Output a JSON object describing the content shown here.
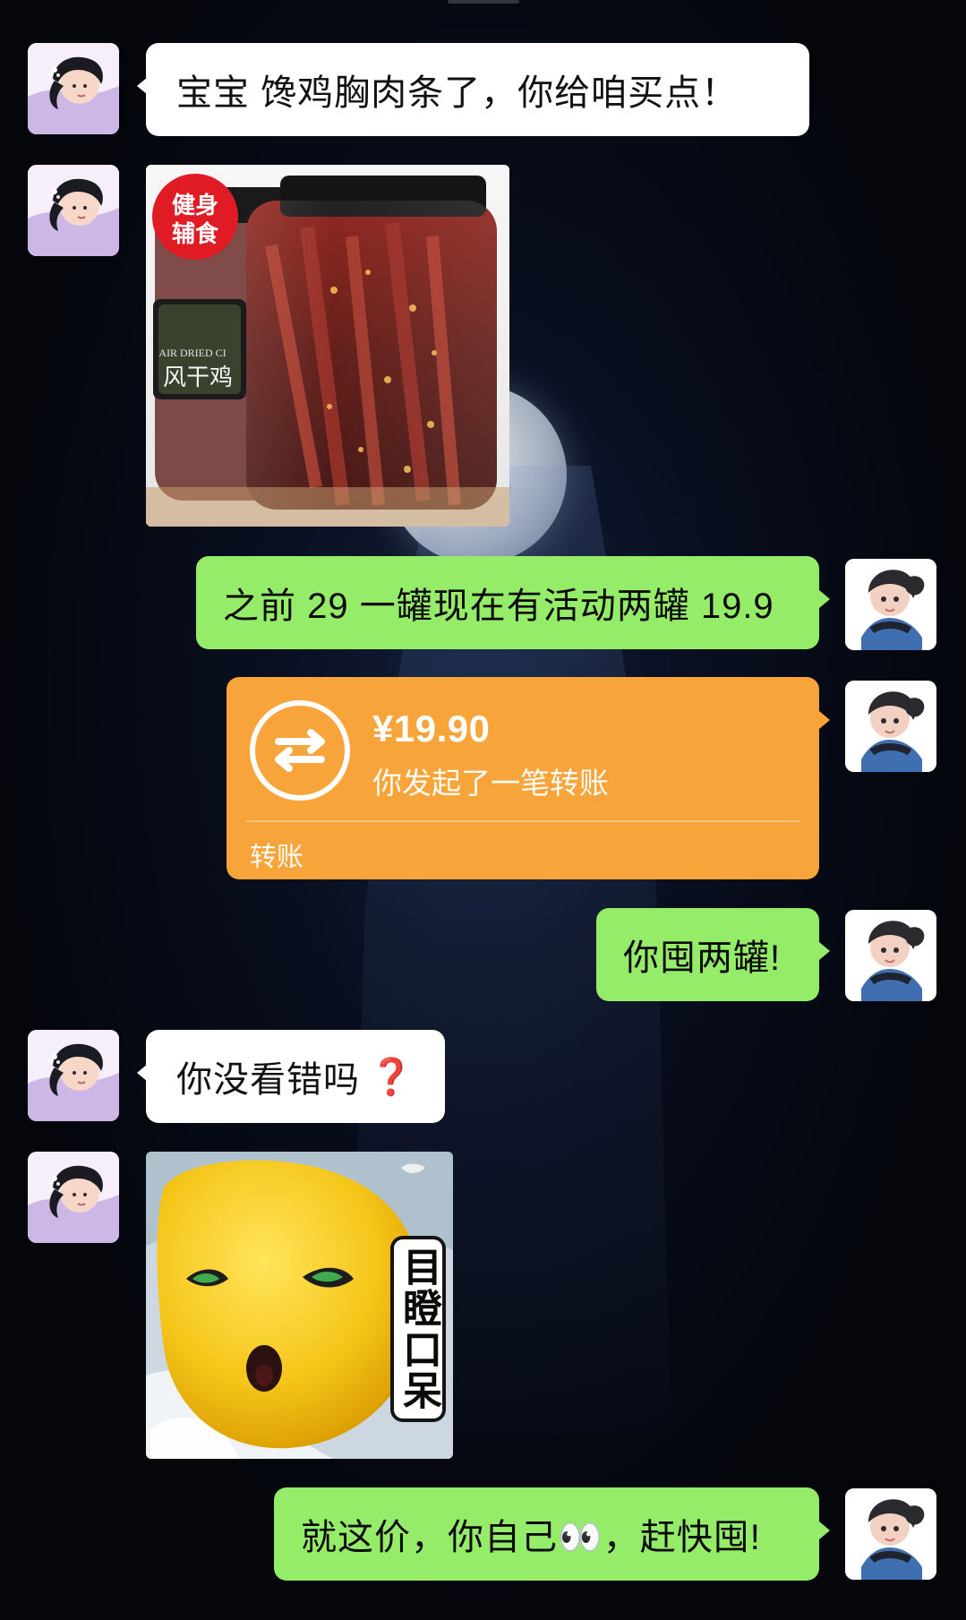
{
  "colors": {
    "incoming_bubble": "#ffffff",
    "outgoing_bubble": "#95ec69",
    "transfer_card": "#f7a43a"
  },
  "messages": {
    "m1": {
      "text": "宝宝 馋鸡胸肉条了，你给咱买点！"
    },
    "product": {
      "badge_line1": "健身",
      "badge_line2": "辅食",
      "label_en": "AIR DRIED CI",
      "label_cn": "风干鸡"
    },
    "m2": {
      "text": "之前 29 一罐现在有活动两罐 19.9"
    },
    "transfer": {
      "amount": "¥19.90",
      "subtitle": "你发起了一笔转账",
      "label": "转账",
      "icon": "transfer-arrows-icon"
    },
    "m3": {
      "text": "你囤两罐!"
    },
    "m4": {
      "text": "你没看错吗",
      "emoji": "❓"
    },
    "sticker": {
      "caption": "目瞪口呆"
    },
    "m5": {
      "text": "就这价，你自己👀，赶快囤!"
    }
  }
}
